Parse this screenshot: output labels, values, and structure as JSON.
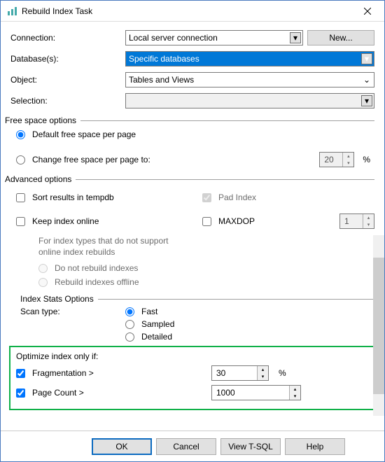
{
  "title": "Rebuild Index Task",
  "labels": {
    "connection": "Connection:",
    "databases": "Database(s):",
    "object": "Object:",
    "selection": "Selection:"
  },
  "fields": {
    "connection": "Local server connection",
    "databases": "Specific databases",
    "object": "Tables and Views",
    "selection": ""
  },
  "buttons": {
    "new": "New...",
    "ok": "OK",
    "cancel": "Cancel",
    "viewtsql": "View T-SQL",
    "help": "Help"
  },
  "freespace": {
    "legend": "Free space options",
    "default": "Default free space per page",
    "change": "Change free space per page to:",
    "value": "20",
    "pct": "%"
  },
  "advanced": {
    "legend": "Advanced options",
    "sort": "Sort results in tempdb",
    "pad": "Pad Index",
    "keep": "Keep index online",
    "maxdop": "MAXDOP",
    "maxdop_val": "1",
    "note": "For index types that do not support online index rebuilds",
    "opt1": "Do not rebuild indexes",
    "opt2": "Rebuild indexes offline"
  },
  "stats": {
    "legend": "Index Stats Options",
    "scan": "Scan type:",
    "fast": "Fast",
    "sampled": "Sampled",
    "detailed": "Detailed"
  },
  "optimize": {
    "header": "Optimize index only if:",
    "frag": "Fragmentation >",
    "frag_val": "30",
    "pct": "%",
    "page": "Page Count >",
    "page_val": "1000"
  }
}
